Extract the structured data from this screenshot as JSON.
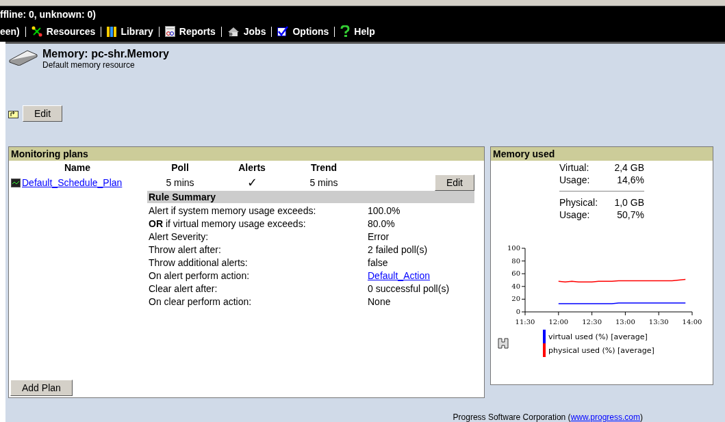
{
  "top_bar": {
    "status": "ffline: 0, unknown: 0)",
    "nav_lead": "een)",
    "nav": [
      {
        "kind": "resources",
        "label": "Resources"
      },
      {
        "kind": "library",
        "label": "Library"
      },
      {
        "kind": "reports",
        "label": "Reports"
      },
      {
        "kind": "jobs",
        "label": "Jobs"
      },
      {
        "kind": "options",
        "label": "Options"
      },
      {
        "kind": "help",
        "label": "Help"
      }
    ]
  },
  "resource": {
    "title": "Memory: pc-shr.Memory",
    "subtitle": "Default memory resource",
    "edit_button": "Edit"
  },
  "monitoring_plans": {
    "title": "Monitoring plans",
    "columns": [
      "Name",
      "Poll",
      "Alerts",
      "Trend"
    ],
    "plans": [
      {
        "name": "Default_Schedule_Plan",
        "poll": "5 mins",
        "alerts": true,
        "alerts_mark": "✓",
        "trend": "5 mins",
        "edit_button": "Edit"
      }
    ],
    "rule_summary": {
      "title": "Rule Summary",
      "rows": [
        {
          "label": "Alert if system memory usage exceeds:",
          "value": "100.0%"
        },
        {
          "label": "**OR** if virtual memory usage exceeds:",
          "value": "80.0%"
        },
        {
          "label": "Alert Severity:",
          "value": "Error"
        },
        {
          "label": "Throw alert after:",
          "value": "2 failed poll(s)"
        },
        {
          "label": "Throw additional alerts:",
          "value": "false"
        },
        {
          "label": "On alert perform action:",
          "value": "Default_Action",
          "kind": "link"
        },
        {
          "label": "Clear alert after:",
          "value": "0 successful poll(s)"
        },
        {
          "label": "On clear perform action:",
          "value": "None"
        }
      ]
    },
    "add_button": "Add Plan"
  },
  "memory_used": {
    "title": "Memory used",
    "stats": [
      {
        "label": "Virtual:",
        "value": "2,4 GB"
      },
      {
        "label": "Usage:",
        "value": "14,6%"
      },
      {
        "label": "Physical:",
        "value": "1,0 GB"
      },
      {
        "label": "Usage:",
        "value": "50,7%"
      }
    ],
    "chart_data": {
      "type": "line",
      "x": [
        12.0,
        12.1,
        12.2,
        12.3,
        12.4,
        12.5,
        12.6,
        12.8,
        12.9,
        13.0,
        13.3,
        13.5,
        13.7,
        13.9
      ],
      "xlim": [
        11.5,
        14.0
      ],
      "ylim": [
        0,
        100
      ],
      "xticks": [
        {
          "value": 11.5,
          "label": "11:30"
        },
        {
          "value": 12.0,
          "label": "12:00"
        },
        {
          "value": 12.5,
          "label": "12:30"
        },
        {
          "value": 13.0,
          "label": "13:00"
        },
        {
          "value": 13.5,
          "label": "13:30"
        },
        {
          "value": 14.0,
          "label": "14:00"
        }
      ],
      "yticks": [
        0,
        20,
        40,
        60,
        80,
        100
      ],
      "series": [
        {
          "name": "virtual used (%) [average]",
          "color": "#0000ff",
          "values": [
            13,
            13,
            13,
            13,
            13,
            13,
            13,
            13,
            14,
            14,
            14,
            14,
            14,
            14
          ]
        },
        {
          "name": "physical used (%) [average]",
          "color": "#ff0000",
          "values": [
            48,
            47,
            48,
            47,
            47,
            47,
            48,
            48,
            49,
            49,
            49,
            49,
            49,
            51
          ]
        }
      ]
    }
  },
  "footer": {
    "text": "Progress Software Corporation (",
    "link": "www.progress.com",
    "tail": ")"
  }
}
